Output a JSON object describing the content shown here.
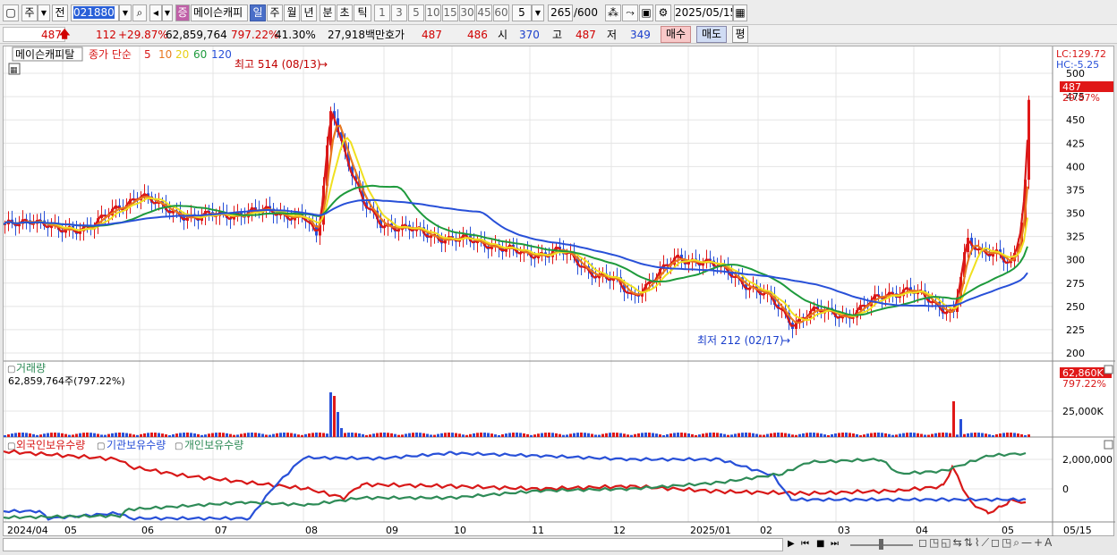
{
  "toolbar": {
    "market_label": "주",
    "prev_label": "전",
    "code_value": "021880",
    "stock_badge": "증",
    "stock_name": "메이슨캐피",
    "period_tabs": [
      "일",
      "주",
      "월",
      "년",
      "분",
      "초",
      "틱"
    ],
    "minute_tabs": [
      "1",
      "3",
      "5",
      "10",
      "15",
      "30",
      "45",
      "60"
    ],
    "interval_value": "5",
    "count_value": "265",
    "count_total": "/600",
    "date_value": "2025/05/15"
  },
  "quote": {
    "price": "487",
    "change": "112",
    "change_pct": "+29.87%",
    "volume": "62,859,764",
    "volume_ratio": "797.22%",
    "turnover": "41.30%",
    "amount": "27,918백만",
    "ask_label": "호가",
    "ask": "487",
    "bid": "486",
    "open_label": "시",
    "open": "370",
    "high_label": "고",
    "high": "487",
    "low_label": "저",
    "low": "349",
    "buy_label": "매수",
    "sell_label": "매도",
    "eval_label": "평"
  },
  "price_panel": {
    "title": "메이슨캐피탈",
    "ma_legend_prefix": "종가 단순",
    "ma_periods": [
      "5",
      "10",
      "20",
      "60",
      "120"
    ],
    "ma_colors": [
      "#d81818",
      "#e87820",
      "#f0e020",
      "#1e9a3c",
      "#2850d8"
    ],
    "lc_label": "LC:129.72",
    "hc_label": "HC:-5.25",
    "price_tag": "487",
    "pct_tag": "29.87%",
    "high_note": "최고 514 (08/13)",
    "low_note": "최저 212 (02/17)",
    "y_ticks": [
      "500",
      "475",
      "450",
      "425",
      "400",
      "375",
      "350",
      "325",
      "300",
      "275",
      "250",
      "225",
      "200"
    ]
  },
  "volume_panel": {
    "title": "거래량",
    "value": "62,859,764주(797.22%)",
    "tag": "62,860K",
    "tag_pct": "797.22%",
    "y_tick": "25,000K"
  },
  "holdings_panel": {
    "legend": [
      "외국인보유수량",
      "기관보유수량",
      "개인보유수량"
    ],
    "colors": [
      "#d81818",
      "#2850d8",
      "#2e8b57"
    ],
    "y_ticks": [
      "2,000,000",
      "0"
    ]
  },
  "x_axis": [
    "2024/04",
    "05",
    "06",
    "07",
    "08",
    "09",
    "10",
    "11",
    "12",
    "2025/01",
    "02",
    "03",
    "04",
    "05",
    "05/15"
  ],
  "chart_data": {
    "type": "line",
    "series": [
      {
        "name": "종가",
        "x_dates": [
          "2024/04",
          "05",
          "06",
          "07",
          "08/13",
          "09",
          "10",
          "11",
          "12",
          "2025/01",
          "02/17",
          "03",
          "04",
          "05/15"
        ],
        "values": [
          335,
          340,
          365,
          345,
          350,
          325,
          320,
          305,
          285,
          295,
          235,
          240,
          255,
          487
        ]
      }
    ],
    "ylim": [
      200,
      510
    ]
  }
}
